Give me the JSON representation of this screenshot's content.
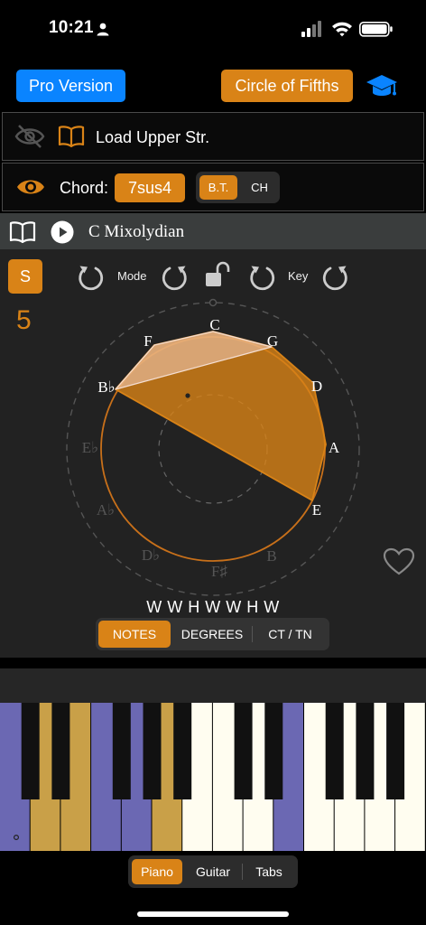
{
  "status": {
    "time": "10:21"
  },
  "header": {
    "pro_label": "Pro Version",
    "cof_label": "Circle of Fifths",
    "accent": "#d98317",
    "blue": "#0a84ff"
  },
  "upper_row": {
    "label": "Load Upper Str.",
    "icons": [
      "eye-slash-icon",
      "book-icon"
    ]
  },
  "chord_row": {
    "label": "Chord:",
    "chord": "7sus4",
    "seg": [
      {
        "label": "B.T.",
        "active": true
      },
      {
        "label": "CH",
        "active": false
      }
    ]
  },
  "scale_bar": {
    "name": "C Mixolydian",
    "icons": [
      "book-icon",
      "play-icon"
    ]
  },
  "controls": {
    "s_label": "S",
    "step_number": "5",
    "mode_label": "Mode",
    "key_label": "Key"
  },
  "circle": {
    "active_notes": [
      "C",
      "G",
      "D",
      "A",
      "E",
      "B♭",
      "F"
    ],
    "inactive_notes": [
      "E♭",
      "A♭",
      "D♭",
      "F♯",
      "B"
    ],
    "labels": {
      "C": "C",
      "G": "G",
      "D": "D",
      "A": "A",
      "E": "E",
      "B": "B",
      "Fs": "F♯",
      "Db": "D♭",
      "Ab": "A♭",
      "Eb": "E♭",
      "Bb": "B♭",
      "F": "F"
    }
  },
  "steps": "W W H W W H W",
  "view_seg": [
    {
      "label": "NOTES",
      "active": true
    },
    {
      "label": "DEGREES",
      "active": false
    },
    {
      "label": "CT / TN",
      "active": false
    }
  ],
  "piano": {
    "scale_color": "#6b68b3",
    "chord_color": "#c9a048",
    "white_key_color": "#fffdf0"
  },
  "instrument_seg": [
    {
      "label": "Piano",
      "active": true
    },
    {
      "label": "Guitar",
      "active": false
    },
    {
      "label": "Tabs",
      "active": false
    }
  ]
}
